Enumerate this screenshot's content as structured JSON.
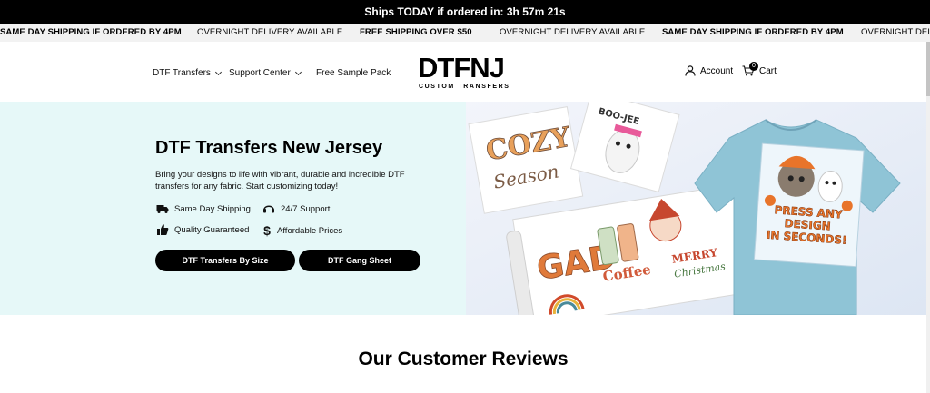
{
  "countdown": {
    "text": "Ships TODAY if ordered in: 3h 57m 21s"
  },
  "ticker": {
    "items": [
      "SAME DAY SHIPPING IF ORDERED BY 4PM",
      "OVERNIGHT DELIVERY AVAILABLE",
      "FREE SHIPPING OVER $50",
      "OVERNIGHT DELIVERY AVAILABLE",
      "SAME DAY SHIPPING IF ORDERED BY 4PM",
      "OVERNIGHT DELIVERY AVAILABLE"
    ]
  },
  "nav": {
    "items": [
      {
        "label": "DTF Transfers"
      },
      {
        "label": "Support Center"
      },
      {
        "label": "Free Sample Pack"
      }
    ],
    "account_label": "Account",
    "cart_label": "Cart",
    "cart_count": "0"
  },
  "logo": {
    "main": "DTFNJ",
    "sub": "CUSTOM TRANSFERS"
  },
  "hero": {
    "title": "DTF Transfers New Jersey",
    "description": "Bring your designs to life with vibrant, durable and incredible DTF transfers for any fabric. Start customizing today!",
    "features": [
      {
        "icon": "truck-icon",
        "label": "Same Day Shipping"
      },
      {
        "icon": "headset-icon",
        "label": "24/7 Support"
      },
      {
        "icon": "thumbs-up-icon",
        "label": "Quality Guaranteed"
      },
      {
        "icon": "dollar-icon",
        "label": "Affordable Prices"
      }
    ],
    "buttons": [
      {
        "label": "DTF Transfers By Size"
      },
      {
        "label": "DTF Gang Sheet"
      }
    ],
    "art": {
      "sheet1_top": "COZY",
      "sheet1_bottom": "Season",
      "sheet2": "BOO-JEE",
      "roll_left": "GAD",
      "roll_coffee": "Coffee",
      "roll_merry": "MERRY",
      "roll_christmas": "Christmas",
      "shirt_text_1": "PRESS ANY",
      "shirt_text_2": "DESIGN",
      "shirt_text_3": "IN SECONDS!"
    }
  },
  "reviews": {
    "title": "Our Customer Reviews"
  },
  "colors": {
    "hero_bg": "#e6f8f8",
    "shirt": "#8fc4d6",
    "accent_orange": "#e8742a"
  }
}
